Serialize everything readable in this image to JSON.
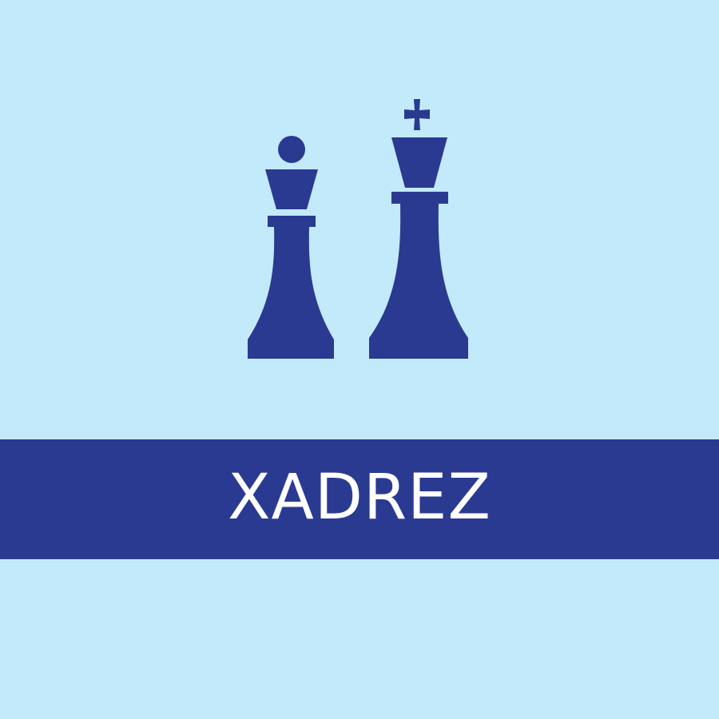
{
  "colors": {
    "background": "#c3eafa",
    "accent": "#2a3a91",
    "text": "#ffffff"
  },
  "icons": {
    "queen": "chess-queen-icon",
    "king": "chess-king-icon"
  },
  "banner": {
    "label": "XADREZ"
  }
}
